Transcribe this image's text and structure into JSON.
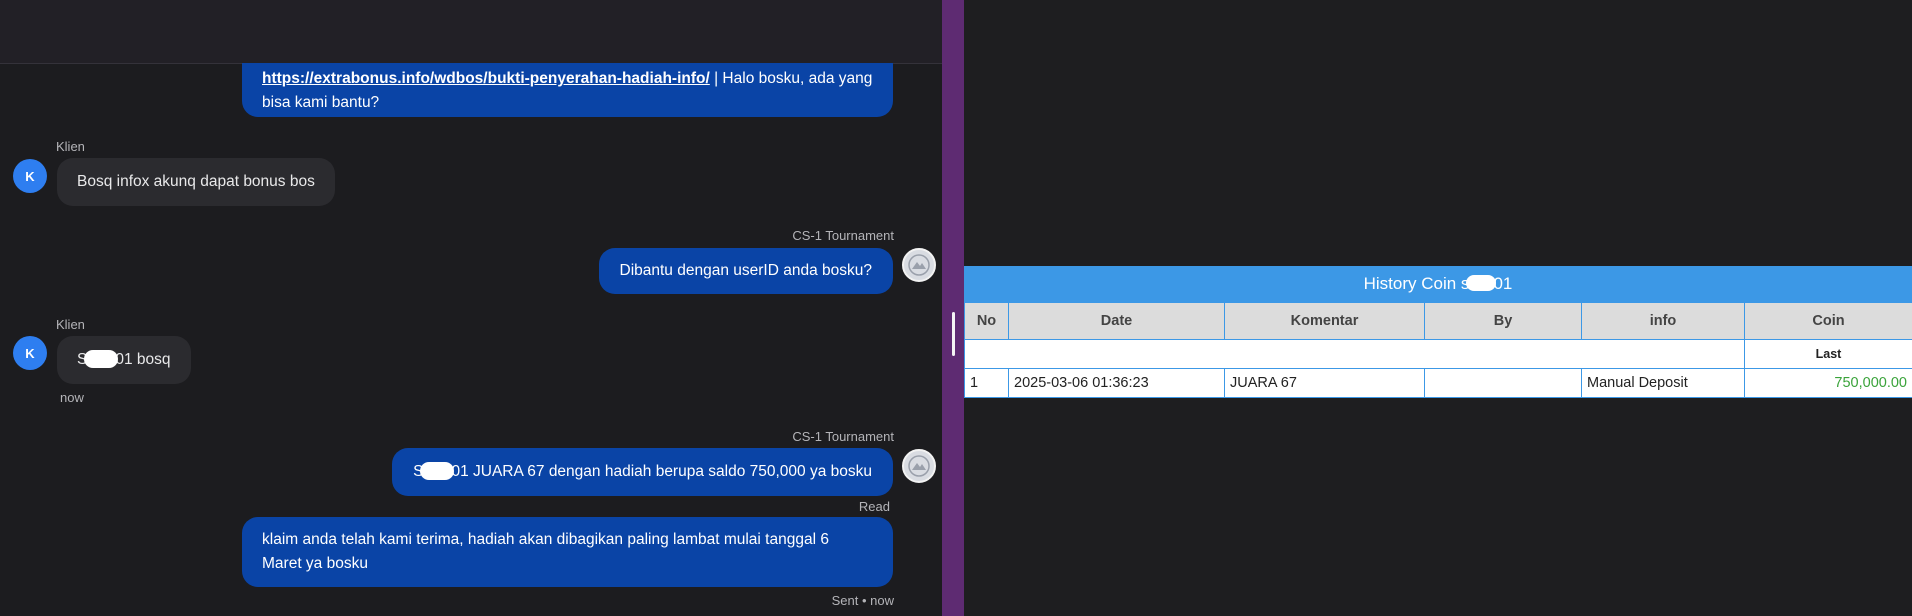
{
  "chat": {
    "msg1": {
      "link": "https://extrabonus.info/wdbos/bukti-penyerahan-hadiah-info/",
      "text_a": " | Halo bosku, ada yang",
      "text_b": "bisa kami bantu?"
    },
    "client_label_1": "Klien",
    "client_avatar_letter": "K",
    "msg2": "Bosq infox akunq dapat bonus bos",
    "agent_label_1": "CS-1 Tournament",
    "msg3": "Dibantu dengan userID anda bosku?",
    "client_label_2": "Klien",
    "msg4": {
      "prefix": "S",
      "suffix": "01 bosq"
    },
    "msg4_time": "now",
    "agent_label_2": "CS-1 Tournament",
    "msg5": {
      "prefix": "S",
      "suffix": "01 JUARA 67 dengan hadiah berupa saldo 750,000 ya bosku"
    },
    "msg5_status": "Read",
    "msg6": {
      "line1": "klaim anda telah kami terima, hadiah akan dibagikan paling lambat mulai tanggal 6",
      "line2": "Maret ya bosku"
    },
    "msg6_status": "Sent • now"
  },
  "history": {
    "title_prefix": "History Coin s",
    "title_suffix": "01",
    "columns": [
      "No",
      "Date",
      "Komentar",
      "By",
      "info",
      "Coin"
    ],
    "last_label": "Last",
    "rows": [
      {
        "no": "1",
        "date": "2025-03-06 01:36:23",
        "komentar": "JUARA 67",
        "by": "",
        "info": "Manual Deposit",
        "coin": "750,000.00"
      }
    ]
  },
  "colors": {
    "outgoing_bubble": "#0a44a6",
    "incoming_bubble": "#2b2b2f",
    "divider": "#5e2b72",
    "table_header": "#3c98e6",
    "coin_value": "#3aa33a"
  }
}
